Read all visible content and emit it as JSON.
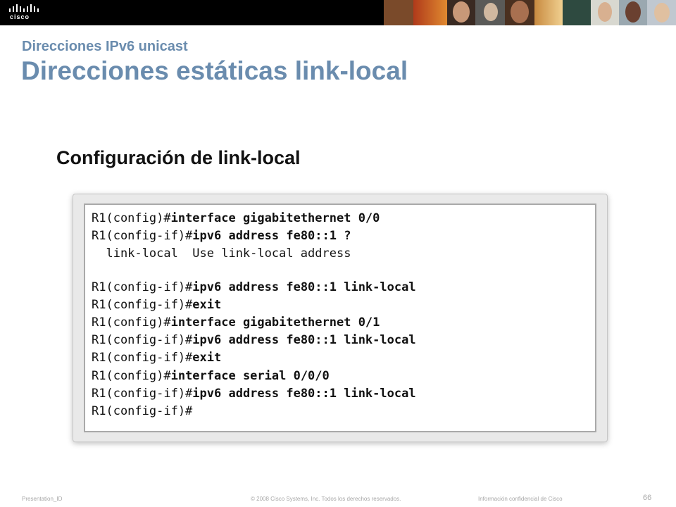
{
  "header": {
    "logo_text": "cisco",
    "colors": {
      "bar": "#000000",
      "logo": "#ffffff"
    }
  },
  "slide": {
    "subtitle": "Direcciones IPv6 unicast",
    "title": "Direcciones estáticas link-local",
    "section_heading": "Configuración de link-local",
    "accent_color": "#6a8cae"
  },
  "terminal": {
    "lines": [
      {
        "prompt": "R1(config)#",
        "cmd": "interface gigabitethernet 0/0"
      },
      {
        "prompt": "R1(config-if)#",
        "cmd": "ipv6 address fe80::1 ?"
      },
      {
        "help": "  link-local  Use link-local address"
      },
      {
        "blank": true
      },
      {
        "prompt": "R1(config-if)#",
        "cmd": "ipv6 address fe80::1 link-local"
      },
      {
        "prompt": "R1(config-if)#",
        "cmd": "exit"
      },
      {
        "prompt": "R1(config)#",
        "cmd": "interface gigabitethernet 0/1"
      },
      {
        "prompt": "R1(config-if)#",
        "cmd": "ipv6 address fe80::1 link-local"
      },
      {
        "prompt": "R1(config-if)#",
        "cmd": "exit"
      },
      {
        "prompt": "R1(config)#",
        "cmd": "interface serial 0/0/0"
      },
      {
        "prompt": "R1(config-if)#",
        "cmd": "ipv6 address fe80::1 link-local"
      },
      {
        "prompt": "R1(config-if)#",
        "cmd": ""
      }
    ]
  },
  "footer": {
    "left": "Presentation_ID",
    "center": "© 2008 Cisco Systems, Inc. Todos los derechos reservados.",
    "right": "Información confidencial de Cisco",
    "page_number": "66"
  }
}
